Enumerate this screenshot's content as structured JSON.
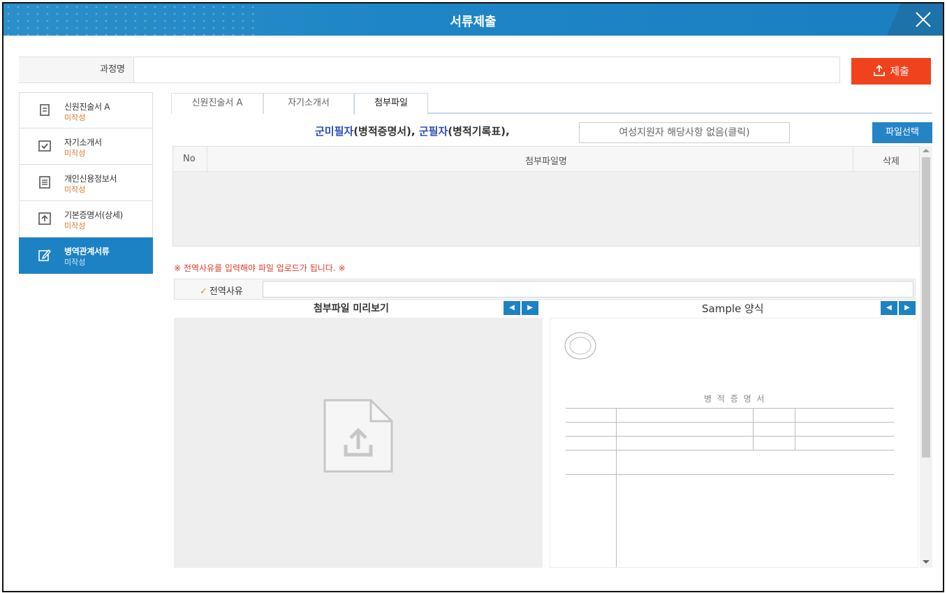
{
  "window": {
    "title": "서류제출"
  },
  "course": {
    "label": "과정명",
    "value": ""
  },
  "submit_button": {
    "label": "제출"
  },
  "sidebar": {
    "items": [
      {
        "name": "신원진술서 A",
        "state": "미작성",
        "icon": "document-icon",
        "active": false
      },
      {
        "name": "자기소개서",
        "state": "미작성",
        "icon": "checkbox-icon",
        "active": false
      },
      {
        "name": "개인신용정보서",
        "state": "미작성",
        "icon": "list-document-icon",
        "active": false
      },
      {
        "name": "기본증명서(상세)",
        "state": "미작성",
        "icon": "upload-box-icon",
        "active": false
      },
      {
        "name": "병역관계서류",
        "state": "미작성",
        "icon": "edit-icon",
        "active": true
      }
    ]
  },
  "tabs": [
    {
      "label": "신원진술서 A",
      "active": false
    },
    {
      "label": "자기소개서",
      "active": false
    },
    {
      "label": "첨부파일",
      "active": true
    }
  ],
  "notice": {
    "part1_blue": "군미필자",
    "part1_rest": "(병적증명서),",
    "part2_blue": "군필자",
    "part2_rest": "(병적기록표),"
  },
  "female_button": {
    "label": "여성지원자 해당사항 없음(클릭)"
  },
  "file_select_button": {
    "label": "파일선택"
  },
  "file_table": {
    "columns": {
      "no": "No",
      "name": "첨부파일명",
      "delete": "삭제"
    },
    "rows": []
  },
  "warning": "※ 전역사유를 입력해야 파일 업로드가 됩니다. ※",
  "discharge_reason": {
    "label": "전역사유",
    "value": ""
  },
  "preview_panel": {
    "title": "첨부파일 미리보기",
    "prev": "◀",
    "next": "▶"
  },
  "sample_panel": {
    "title": "Sample 양식",
    "prev": "◀",
    "next": "▶",
    "doc_title": "병 적 증 명 서"
  },
  "colors": {
    "title_bar": "#1f86c6",
    "submit": "#f0421c",
    "active_side": "#1d82c4",
    "notice_blue": "#2a4fb5",
    "warning": "#e03a2a",
    "state_orange": "#e07a2f"
  }
}
